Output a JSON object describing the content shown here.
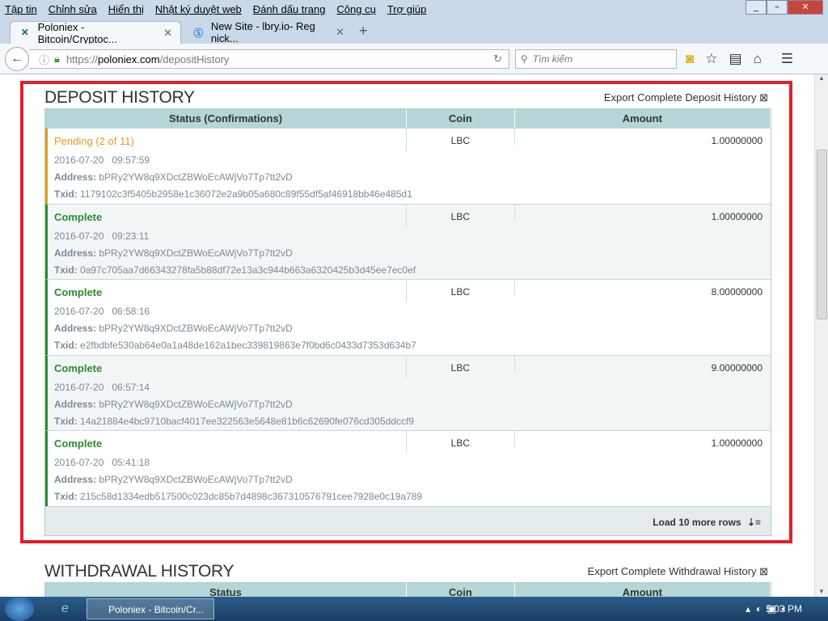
{
  "menu": [
    "Tập tin",
    "Chỉnh sửa",
    "Hiển thị",
    "Nhật ký duyệt web",
    "Đánh dấu trang",
    "Công cụ",
    "Trợ giúp"
  ],
  "tabs": [
    {
      "title": "Poloniex - Bitcoin/Cryptoc...",
      "active": true
    },
    {
      "title": "New Site - lbry.io- Reg nick...",
      "active": false
    }
  ],
  "url": {
    "prefix": "https://",
    "domain": "poloniex.com",
    "path": "/depositHistory"
  },
  "search_placeholder": "Tìm kiếm",
  "deposit": {
    "title": "DEPOSIT HISTORY",
    "export": "Export Complete Deposit History",
    "columns": [
      "Status (Confirmations)",
      "Coin",
      "Amount"
    ],
    "address_label": "Address:",
    "txid_label": "Txid:",
    "rows": [
      {
        "status": "Pending (2 of 11)",
        "coin": "LBC",
        "amount": "1.00000000",
        "date": "2016-07-20   09:57:59",
        "address": "bPRy2YW8q9XDctZBWoEcAWjVo7Tp7tt2vD",
        "txid": "1179102c3f5405b2958e1c36072e2a9b05a680c89f55df5af46918bb46e485d1"
      },
      {
        "status": "Complete",
        "coin": "LBC",
        "amount": "1.00000000",
        "date": "2016-07-20   09:23:11",
        "address": "bPRy2YW8q9XDctZBWoEcAWjVo7Tp7tt2vD",
        "txid": "0a97c705aa7d66343278fa5b88df72e13a3c944b663a6320425b3d45ee7ec0ef"
      },
      {
        "status": "Complete",
        "coin": "LBC",
        "amount": "8.00000000",
        "date": "2016-07-20   06:58:16",
        "address": "bPRy2YW8q9XDctZBWoEcAWjVo7Tp7tt2vD",
        "txid": "e2fbdbfe530ab64e0a1a48de162a1bec339819863e7f0bd6c0433d7353d634b7"
      },
      {
        "status": "Complete",
        "coin": "LBC",
        "amount": "9.00000000",
        "date": "2016-07-20   06:57:14",
        "address": "bPRy2YW8q9XDctZBWoEcAWjVo7Tp7tt2vD",
        "txid": "14a21884e4bc9710bacf4017ee322563e5648e81b6c62690fe076cd305ddccf9"
      },
      {
        "status": "Complete",
        "coin": "LBC",
        "amount": "1.00000000",
        "date": "2016-07-20   05:41:18",
        "address": "bPRy2YW8q9XDctZBWoEcAWjVo7Tp7tt2vD",
        "txid": "215c58d1334edb517500c023dc85b7d4898c367310576791cee7928e0c19a789"
      }
    ],
    "load_more": "Load 10 more rows"
  },
  "withdrawal": {
    "title": "WITHDRAWAL HISTORY",
    "export": "Export Complete Withdrawal History",
    "columns": [
      "Status",
      "Coin",
      "Amount"
    ]
  },
  "taskbar": {
    "app": "Poloniex - Bitcoin/Cr...",
    "clock": "5:03 PM"
  },
  "colors": {
    "complete": "#2e8b2e",
    "pending": "#e39a1a",
    "header": "#b4d6d7",
    "highlight": "#e0202a"
  }
}
